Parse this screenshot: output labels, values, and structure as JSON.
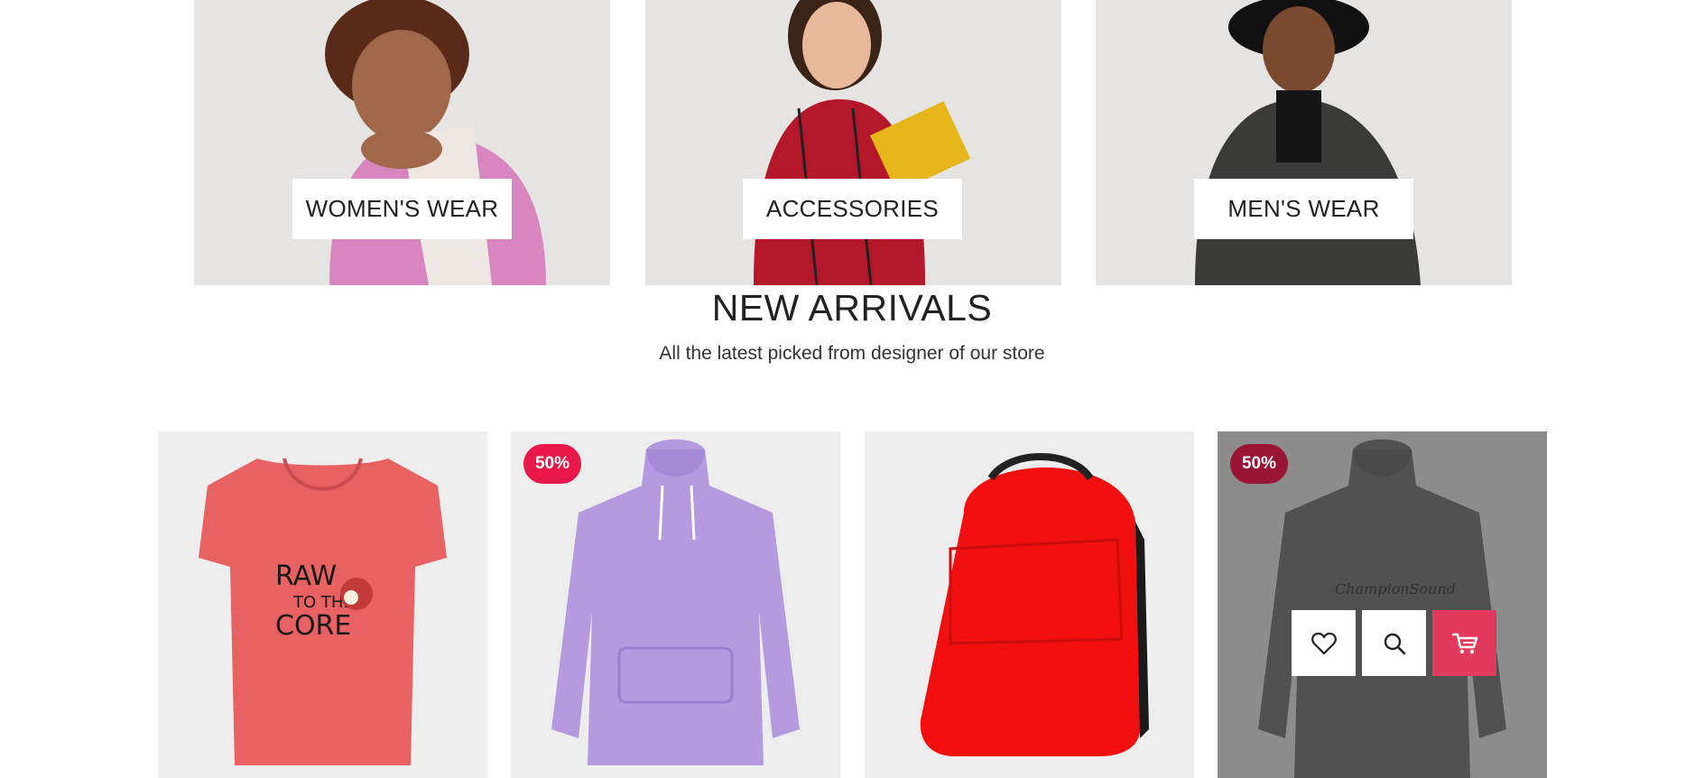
{
  "categories": [
    {
      "label": "WOMEN'S WEAR"
    },
    {
      "label": "ACCESSORIES"
    },
    {
      "label": "MEN'S WEAR"
    }
  ],
  "new_arrivals": {
    "title": "NEW ARRIVALS",
    "subtitle": "All the latest picked from designer of our store"
  },
  "products": [
    {
      "image": "coral-tshirt",
      "badge": ""
    },
    {
      "image": "lavender-hoodie",
      "badge": "50%"
    },
    {
      "image": "red-backpack",
      "badge": ""
    },
    {
      "image": "grey-hoodie",
      "badge": "50%",
      "tshirt_text": "RAW TO THE CORE"
    }
  ],
  "icons": {
    "wishlist": "heart-icon",
    "quick_view": "search-icon",
    "add_to_cart": "cart-icon"
  },
  "colors": {
    "accent": "#e8194a",
    "cart_button": "#e23a5c"
  }
}
